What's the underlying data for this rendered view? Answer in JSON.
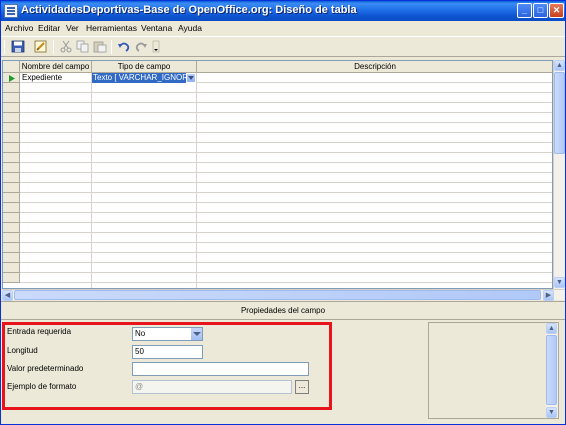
{
  "window": {
    "title": "ActividadesDeportivas-Base de OpenOffice.org: Diseño de tabla",
    "controls": {
      "minimize": "_",
      "maximize": "□",
      "close": "✕"
    }
  },
  "menu": [
    {
      "label": "Archivo"
    },
    {
      "label": "Editar"
    },
    {
      "label": "Ver"
    },
    {
      "label": "Herramientas"
    },
    {
      "label": "Ventana"
    },
    {
      "label": "Ayuda"
    }
  ],
  "toolbar": {
    "icons": [
      "save-icon",
      "edit-icon",
      "cut-icon",
      "copy-icon",
      "paste-icon",
      "undo-icon",
      "redo-icon",
      "more-icon"
    ]
  },
  "grid": {
    "columns": [
      "Nombre del campo",
      "Tipo de campo",
      "Descripción"
    ],
    "rows": [
      {
        "name": "Expediente",
        "type": "Texto [ VARCHAR_IGNORE",
        "description": ""
      }
    ]
  },
  "properties": {
    "title": "Propiedades del campo",
    "entrada_requerida": {
      "label": "Entrada requerida",
      "value": "No"
    },
    "longitud": {
      "label": "Longitud",
      "value": "50"
    },
    "valor_predeterminado": {
      "label": "Valor predeterminado",
      "value": ""
    },
    "ejemplo_formato": {
      "label": "Ejemplo de formato",
      "value": "@",
      "button": "..."
    }
  },
  "colors": {
    "highlight": "#e8141c",
    "selection": "#316ac5",
    "titlebar": "#0a5fd8"
  }
}
